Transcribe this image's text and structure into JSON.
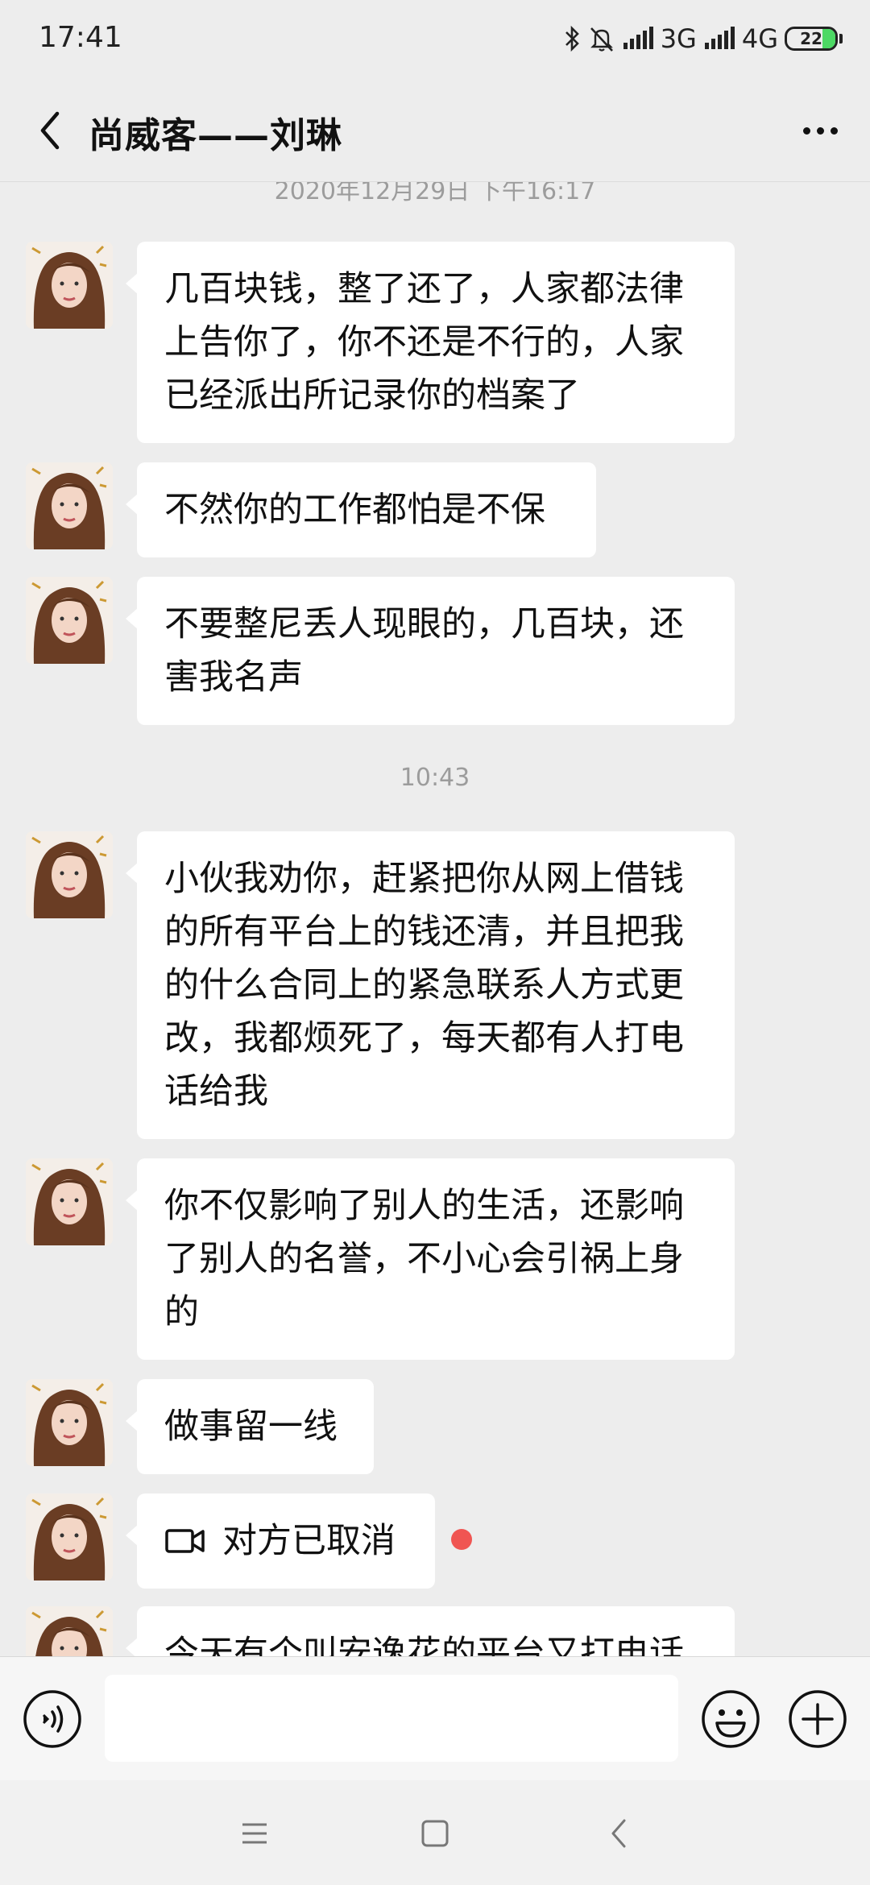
{
  "status_bar": {
    "time": "17:41",
    "network_1": "3G",
    "network_2": "4G",
    "battery": "22",
    "icons": [
      "bluetooth-icon",
      "mute-bell-icon",
      "signal-icon",
      "signal-icon",
      "battery-icon"
    ]
  },
  "header": {
    "title": "尚威客——刘琳",
    "back_icon": "chevron-left-icon",
    "more_icon": "more-dots-icon"
  },
  "chat": {
    "timestamp_1": "2020年12月29日 下午16:17",
    "timestamp_2": "10:43",
    "messages": [
      {
        "lines": [
          "几百块钱，整了还了，人家都法律",
          "上告你了，你不还是不行的，人家",
          "已经派出所记录你的档案了"
        ]
      },
      {
        "lines": [
          "不然你的工作都怕是不保"
        ]
      },
      {
        "lines": [
          "不要整尼丢人现眼的，几百块，还",
          "害我名声"
        ]
      },
      {
        "lines": [
          "小伙我劝你，赶紧把你从网上借钱",
          "的所有平台上的钱还清，并且把我",
          "的什么合同上的紧急联系人方式更",
          "改，我都烦死了，每天都有人打电",
          "话给我"
        ]
      },
      {
        "lines": [
          "你不仅影响了别人的生活，还影响",
          "了别人的名誉，不小心会引祸上身",
          "的"
        ]
      },
      {
        "lines": [
          "做事留一线"
        ]
      },
      {
        "call_text": "对方已取消",
        "call_icon": "video-call-icon"
      },
      {
        "lines": [
          "今天有个叫安逸花的平台又打电话"
        ]
      }
    ]
  },
  "input_bar": {
    "voice_icon": "voice-icon",
    "emoji_icon": "emoji-icon",
    "plus_icon": "plus-icon",
    "placeholder": ""
  },
  "nav_bar": {
    "icons": [
      "menu-icon",
      "home-icon",
      "back-icon"
    ]
  },
  "colors": {
    "background": "#ededed",
    "bubble": "#ffffff",
    "unread": "#f05552",
    "battery": "#4cd964"
  }
}
